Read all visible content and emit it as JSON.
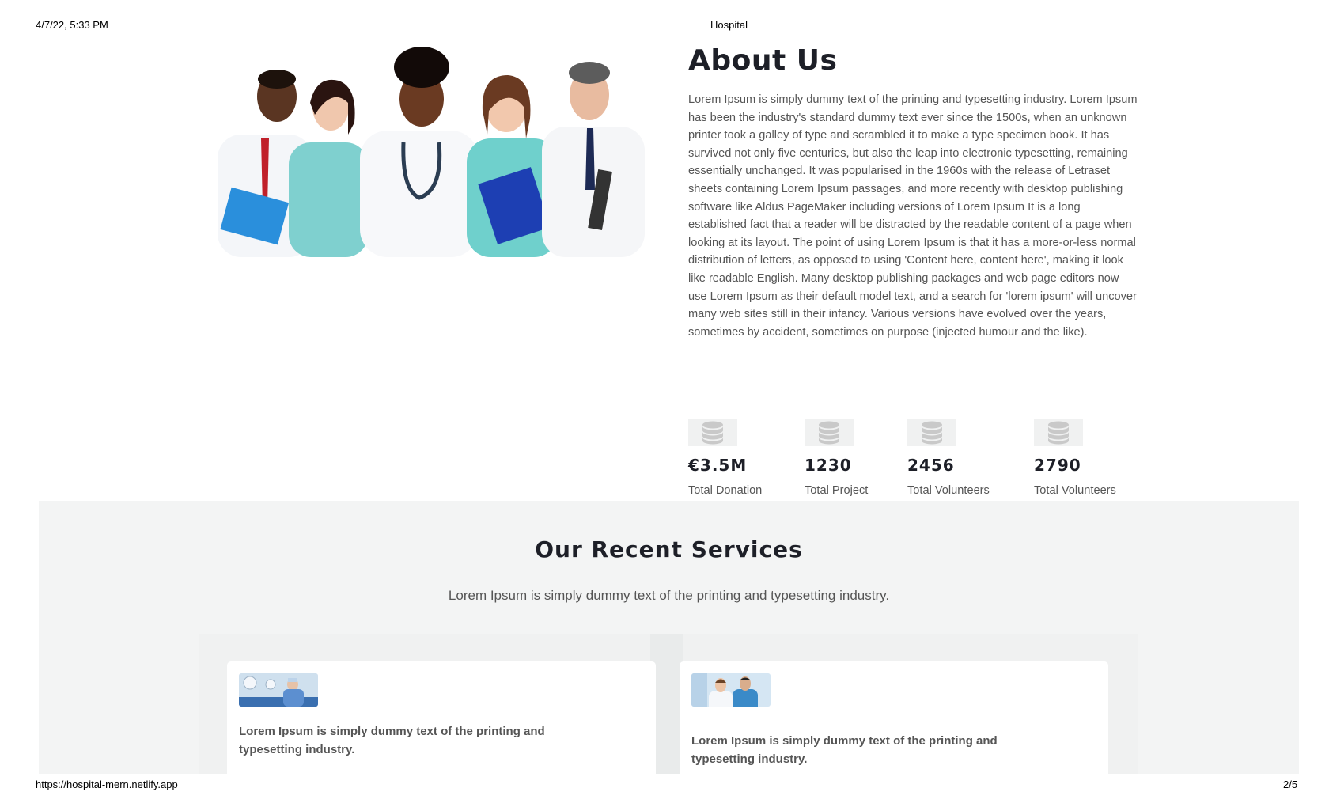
{
  "print_header": {
    "date": "4/7/22, 5:33 PM",
    "title": "Hospital"
  },
  "print_footer": {
    "url": "https://hospital-mern.netlify.app",
    "page": "2/5"
  },
  "about": {
    "title": "About Us",
    "body": "Lorem Ipsum is simply dummy text of the printing and typesetting industry. Lorem Ipsum has been the industry's standard dummy text ever since the 1500s, when an unknown printer took a galley of type and scrambled it to make a type specimen book. It has survived not only five centuries, but also the leap into electronic typesetting, remaining essentially unchanged. It was popularised in the 1960s with the release of Letraset sheets containing Lorem Ipsum passages, and more recently with desktop publishing software like Aldus PageMaker including versions of Lorem Ipsum It is a long established fact that a reader will be distracted by the readable content of a page when looking at its layout. The point of using Lorem Ipsum is that it has a more-or-less normal distribution of letters, as opposed to using 'Content here, content here', making it look like readable English. Many desktop publishing packages and web page editors now use Lorem Ipsum as their default model text, and a search for 'lorem ipsum' will uncover many web sites still in their infancy. Various versions have evolved over the years, sometimes by accident, sometimes on purpose (injected humour and the like).",
    "image_icon": "doctors-group-photo"
  },
  "stats": [
    {
      "icon": "database-icon",
      "value": "€3.5M",
      "label": "Total Donation"
    },
    {
      "icon": "database-icon",
      "value": "1230",
      "label": "Total Project"
    },
    {
      "icon": "database-icon",
      "value": "2456",
      "label": "Total Volunteers"
    },
    {
      "icon": "database-icon",
      "value": "2790",
      "label": "Total Volunteers"
    }
  ],
  "services": {
    "title": "Our Recent Services",
    "subtitle": "Lorem Ipsum is simply dummy text of the printing and typesetting industry.",
    "cards": [
      {
        "image": "surgeon-photo",
        "text": "Lorem Ipsum is simply dummy text of the printing and typesetting industry."
      },
      {
        "image": "doctors-pair-photo",
        "text": "Lorem Ipsum is simply dummy text of the printing and typesetting industry."
      }
    ]
  },
  "colors": {
    "background": "#ffffff",
    "section_bg": "#f3f4f4",
    "heading": "#1d1f27",
    "body_text": "#555555"
  }
}
